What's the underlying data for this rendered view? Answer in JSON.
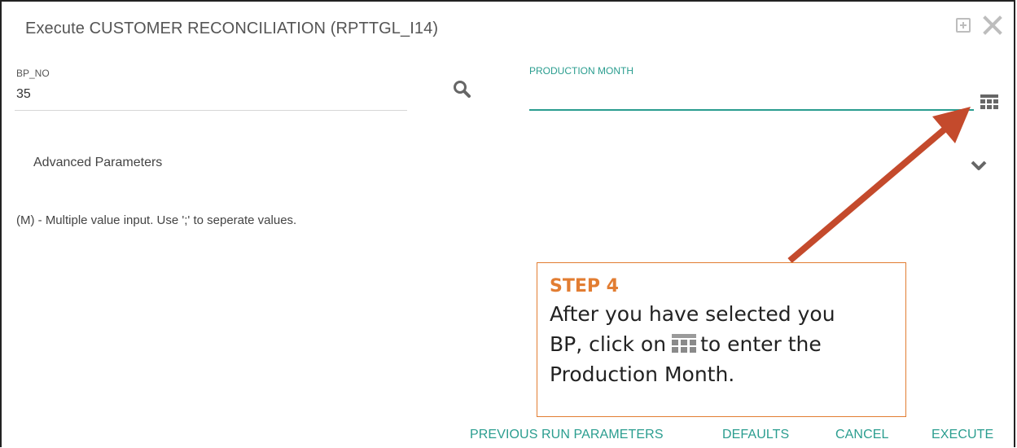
{
  "dialog": {
    "title": "Execute CUSTOMER RECONCILIATION (RPTTGL_I14)"
  },
  "fields": {
    "bp_no": {
      "label": "BP_NO",
      "value": "35",
      "icon": "search-icon"
    },
    "production_month": {
      "label": "PRODUCTION MONTH",
      "value": "",
      "icon": "calendar-icon"
    }
  },
  "advanced": {
    "label": "Advanced Parameters"
  },
  "hint": "(M) - Multiple value input. Use ';' to seperate values.",
  "callout": {
    "title": "STEP 4",
    "line1": "After you have selected you",
    "line2_before": "BP, click on",
    "line2_after": "to enter the",
    "line3": "Production Month."
  },
  "footer": {
    "previous_run": "PREVIOUS RUN PARAMETERS",
    "defaults": "DEFAULTS",
    "cancel": "CANCEL",
    "execute": "EXECUTE"
  },
  "colors": {
    "accent": "#2a9d8f",
    "callout": "#e27d32",
    "arrow": "#c44a2c"
  }
}
